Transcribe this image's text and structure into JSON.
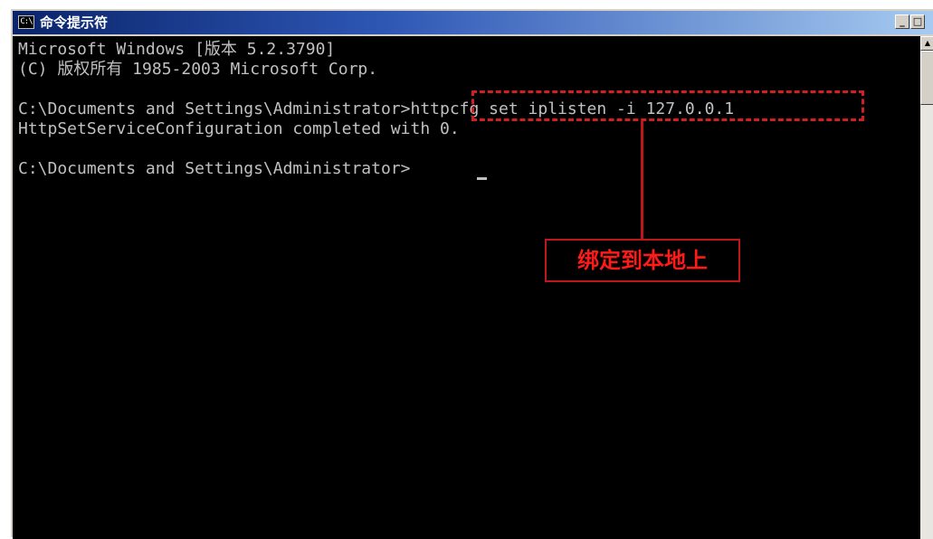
{
  "window": {
    "title": "命令提示符",
    "icon_text": "C:\\",
    "icon_name": "console-icon",
    "minimize_glyph": "_",
    "maximize_glyph": "□"
  },
  "console": {
    "lines": [
      "Microsoft Windows [版本 5.2.3790]",
      "(C) 版权所有 1985-2003 Microsoft Corp.",
      "",
      "C:\\Documents and Settings\\Administrator>httpcfg set iplisten -i 127.0.0.1",
      "HttpSetServiceConfiguration completed with 0.",
      "",
      "C:\\Documents and Settings\\Administrator>"
    ]
  },
  "annotation": {
    "label": "绑定到本地上",
    "color": "#d02020"
  },
  "scrollbar": {
    "up_arrow": "▲"
  },
  "colors": {
    "console_bg": "#000000",
    "console_text": "#c0c0c0",
    "titlebar_start": "#0a246a",
    "titlebar_end": "#a6caf0"
  }
}
